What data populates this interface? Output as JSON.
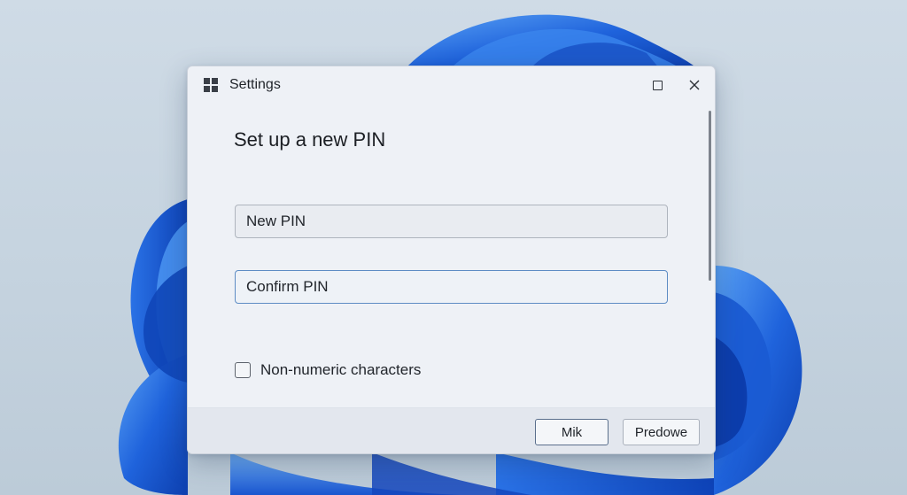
{
  "window": {
    "title": "Settings",
    "app_icon": "windows-logo-icon",
    "controls": [
      "maximize-icon",
      "close-icon"
    ],
    "close_glyph": "✕"
  },
  "dialog": {
    "heading": "Set up a new PIN",
    "new_pin": {
      "placeholder": "New PIN",
      "value": ""
    },
    "confirm_pin": {
      "placeholder": "Confirm PIN",
      "value": ""
    },
    "checkbox": {
      "label": "Non-numeric characters",
      "checked": false
    }
  },
  "footer": {
    "primary_label": "Mik",
    "secondary_label": "Predowe"
  },
  "colors": {
    "accent": "#5d8cc4",
    "wallpaper_blue": "#1a5fd6"
  }
}
